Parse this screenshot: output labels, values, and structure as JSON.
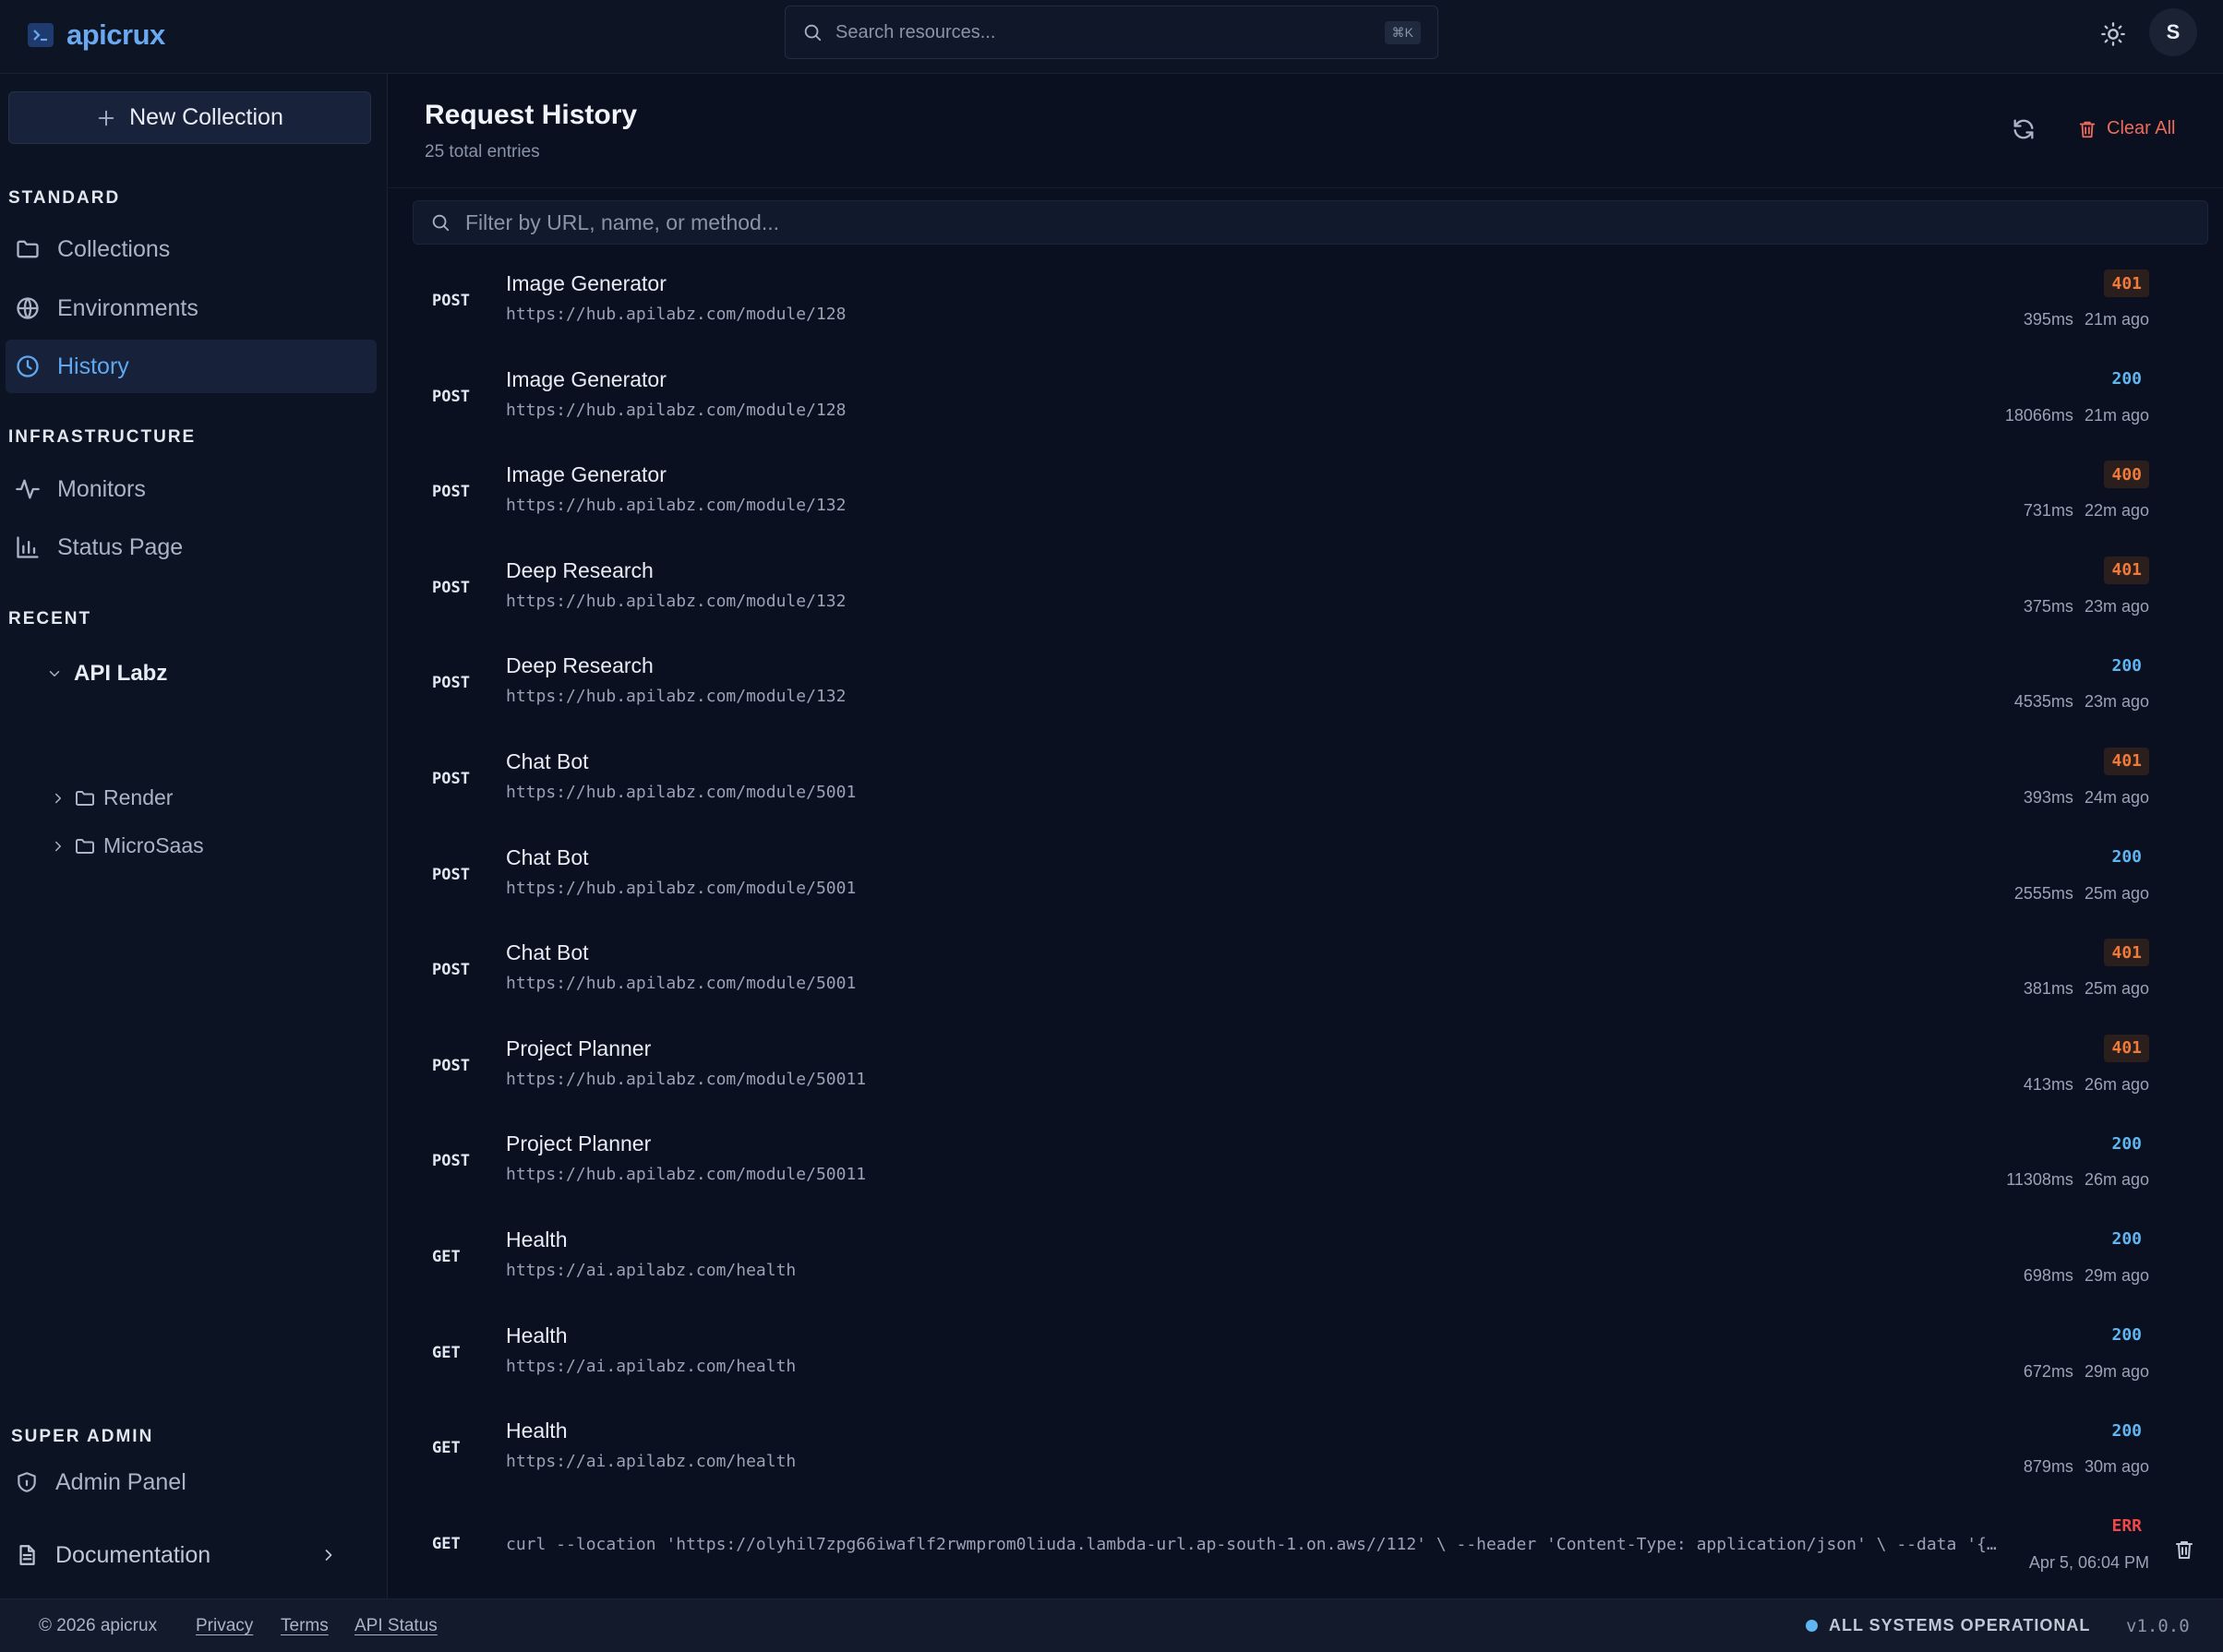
{
  "app": {
    "brand": "apicrux"
  },
  "topbar": {
    "search_placeholder": "Search resources...",
    "search_shortcut": "⌘K",
    "avatar_initial": "S"
  },
  "sidebar": {
    "new_collection": "New Collection",
    "sections": {
      "standard": "STANDARD",
      "infrastructure": "INFRASTRUCTURE",
      "recent": "RECENT",
      "super_admin": "SUPER ADMIN"
    },
    "items": {
      "collections": "Collections",
      "environments": "Environments",
      "history": "History",
      "monitors": "Monitors",
      "status_page": "Status Page",
      "admin_panel": "Admin Panel",
      "documentation": "Documentation"
    },
    "tree": {
      "root": "API Labz",
      "children": [
        "Render",
        "MicroSaas"
      ]
    }
  },
  "main": {
    "title": "Request History",
    "subtitle": "25 total entries",
    "clear_all": "Clear All",
    "filter_placeholder": "Filter by URL, name, or method...",
    "rows": [
      {
        "method": "POST",
        "name": "Image Generator",
        "url": "https://hub.apilabz.com/module/128",
        "status": "401",
        "duration": "395ms",
        "when": "21m ago"
      },
      {
        "method": "POST",
        "name": "Image Generator",
        "url": "https://hub.apilabz.com/module/128",
        "status": "200",
        "duration": "18066ms",
        "when": "21m ago"
      },
      {
        "method": "POST",
        "name": "Image Generator",
        "url": "https://hub.apilabz.com/module/132",
        "status": "400",
        "duration": "731ms",
        "when": "22m ago"
      },
      {
        "method": "POST",
        "name": "Deep Research",
        "url": "https://hub.apilabz.com/module/132",
        "status": "401",
        "duration": "375ms",
        "when": "23m ago"
      },
      {
        "method": "POST",
        "name": "Deep Research",
        "url": "https://hub.apilabz.com/module/132",
        "status": "200",
        "duration": "4535ms",
        "when": "23m ago"
      },
      {
        "method": "POST",
        "name": "Chat Bot",
        "url": "https://hub.apilabz.com/module/5001",
        "status": "401",
        "duration": "393ms",
        "when": "24m ago"
      },
      {
        "method": "POST",
        "name": "Chat Bot",
        "url": "https://hub.apilabz.com/module/5001",
        "status": "200",
        "duration": "2555ms",
        "when": "25m ago"
      },
      {
        "method": "POST",
        "name": "Chat Bot",
        "url": "https://hub.apilabz.com/module/5001",
        "status": "401",
        "duration": "381ms",
        "when": "25m ago"
      },
      {
        "method": "POST",
        "name": "Project Planner",
        "url": "https://hub.apilabz.com/module/50011",
        "status": "401",
        "duration": "413ms",
        "when": "26m ago"
      },
      {
        "method": "POST",
        "name": "Project Planner",
        "url": "https://hub.apilabz.com/module/50011",
        "status": "200",
        "duration": "11308ms",
        "when": "26m ago"
      },
      {
        "method": "GET",
        "name": "Health",
        "url": "https://ai.apilabz.com/health",
        "status": "200",
        "duration": "698ms",
        "when": "29m ago"
      },
      {
        "method": "GET",
        "name": "Health",
        "url": "https://ai.apilabz.com/health",
        "status": "200",
        "duration": "672ms",
        "when": "29m ago"
      },
      {
        "method": "GET",
        "name": "Health",
        "url": "https://ai.apilabz.com/health",
        "status": "200",
        "duration": "879ms",
        "when": "30m ago"
      },
      {
        "method": "GET",
        "name": "",
        "url": "curl --location 'https://olyhil7zpg66iwaflf2rwmprom0liuda.lambda-url.ap-south-1.on.aws//112' \\ --header 'Content-Type: application/json' \\ --data '{\"input\": \"hello\"}'",
        "status": "ERR",
        "duration": "",
        "when": "Apr 5, 06:04 PM"
      }
    ]
  },
  "footer": {
    "copyright": "© 2026 apicrux",
    "privacy": "Privacy",
    "terms": "Terms",
    "api_status": "API Status",
    "system_status": "ALL SYSTEMS OPERATIONAL",
    "version": "v1.0.0"
  },
  "colors": {
    "accent": "#5fa8f0",
    "warn": "#f07a3a",
    "error": "#f04848",
    "danger": "#ef6a5a"
  }
}
